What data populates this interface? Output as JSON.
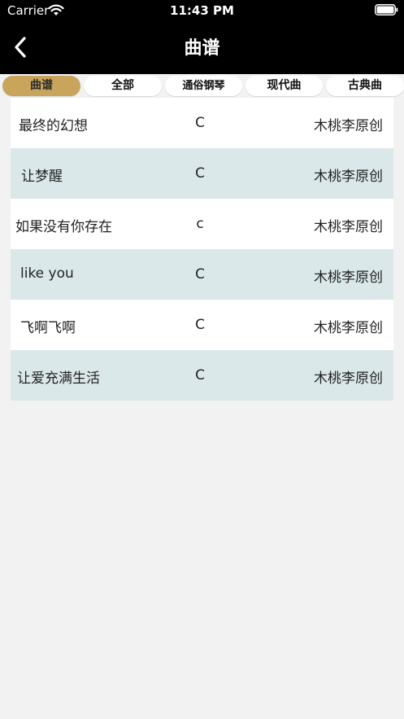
{
  "status_bar": {
    "carrier": "Carrier",
    "time": "11:43 PM"
  },
  "nav": {
    "title": "曲谱",
    "back_icon": "chevron-left-icon"
  },
  "tabs": [
    {
      "label": "曲谱",
      "active": true
    },
    {
      "label": "全部",
      "active": false
    },
    {
      "label": "通俗钢琴",
      "active": false
    },
    {
      "label": "现代曲",
      "active": false
    },
    {
      "label": "古典曲",
      "active": false
    }
  ],
  "songs": [
    {
      "title": "最终的幻想",
      "key": "C",
      "author": "木桃李原创"
    },
    {
      "title": "让梦醒",
      "key": "C",
      "author": "木桃李原创"
    },
    {
      "title": "如果没有你存在",
      "key": "c",
      "author": "木桃李原创"
    },
    {
      "title": "like you",
      "key": "C",
      "author": "木桃李原创"
    },
    {
      "title": "飞啊飞啊",
      "key": "C",
      "author": "木桃李原创"
    },
    {
      "title": "让爱充满生活",
      "key": "C",
      "author": "木桃李原创"
    }
  ],
  "colors": {
    "header_bg": "#000000",
    "active_tab": "#c9a45c",
    "row_alt": "#dbe8ea",
    "page_bg": "#f2f2f2"
  }
}
